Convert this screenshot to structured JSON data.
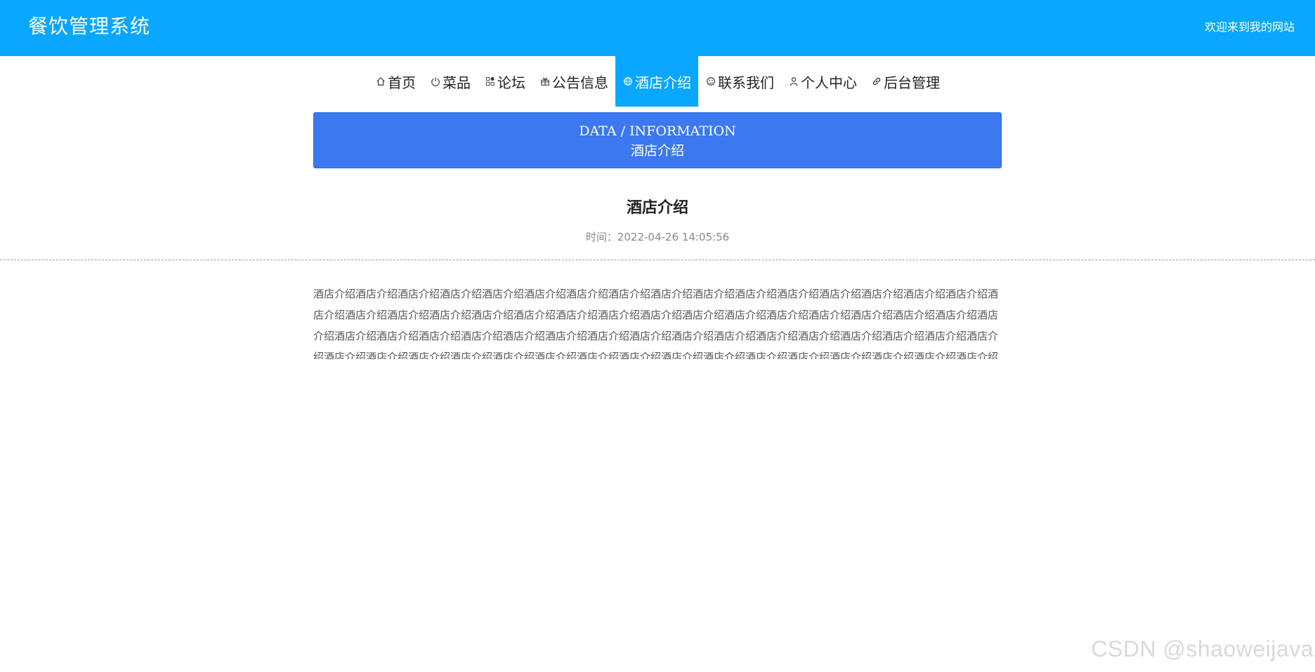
{
  "header": {
    "site_title": "餐饮管理系统",
    "welcome_text": "欢迎来到我的网站",
    "color": "#09a7ff"
  },
  "nav": {
    "items": [
      {
        "icon": "home-icon",
        "label": "首页",
        "active": false
      },
      {
        "icon": "power-icon",
        "label": "菜品",
        "active": false
      },
      {
        "icon": "apps-icon",
        "label": "论坛",
        "active": false
      },
      {
        "icon": "gift-icon",
        "label": "公告信息",
        "active": false
      },
      {
        "icon": "globe-icon",
        "label": "酒店介绍",
        "active": true
      },
      {
        "icon": "smile-icon",
        "label": "联系我们",
        "active": false
      },
      {
        "icon": "user-icon",
        "label": "个人中心",
        "active": false
      },
      {
        "icon": "link-icon",
        "label": "后台管理",
        "active": false
      }
    ]
  },
  "banner": {
    "en": "DATA / INFORMATION",
    "cn": "酒店介绍",
    "color": "#3c78f0"
  },
  "article": {
    "title": "酒店介绍",
    "time": "时间：2022-04-26 14:05:56",
    "body": "酒店介绍酒店介绍酒店介绍酒店介绍酒店介绍酒店介绍酒店介绍酒店介绍酒店介绍酒店介绍酒店介绍酒店介绍酒店介绍酒店介绍酒店介绍酒店介绍酒店介绍酒店介绍酒店介绍酒店介绍酒店介绍酒店介绍酒店介绍酒店介绍酒店介绍酒店介绍酒店介绍酒店介绍酒店介绍酒店介绍酒店介绍酒店介绍酒店介绍酒店介绍酒店介绍酒店介绍酒店介绍酒店介绍酒店介绍酒店介绍酒店介绍酒店介绍酒店介绍酒店介绍酒店介绍酒店介绍酒店介绍酒店介绍酒店介绍酒店介绍酒店介绍酒店介绍酒店介绍酒店介绍酒店介绍酒店介绍酒店介绍酒店介绍酒店介绍酒店介绍酒店介绍酒店介绍酒店介绍酒店介绍酒店介绍酒店介绍酒店介绍酒店介绍酒店介绍酒店介绍"
  },
  "watermark": "CSDN @shaoweijava"
}
